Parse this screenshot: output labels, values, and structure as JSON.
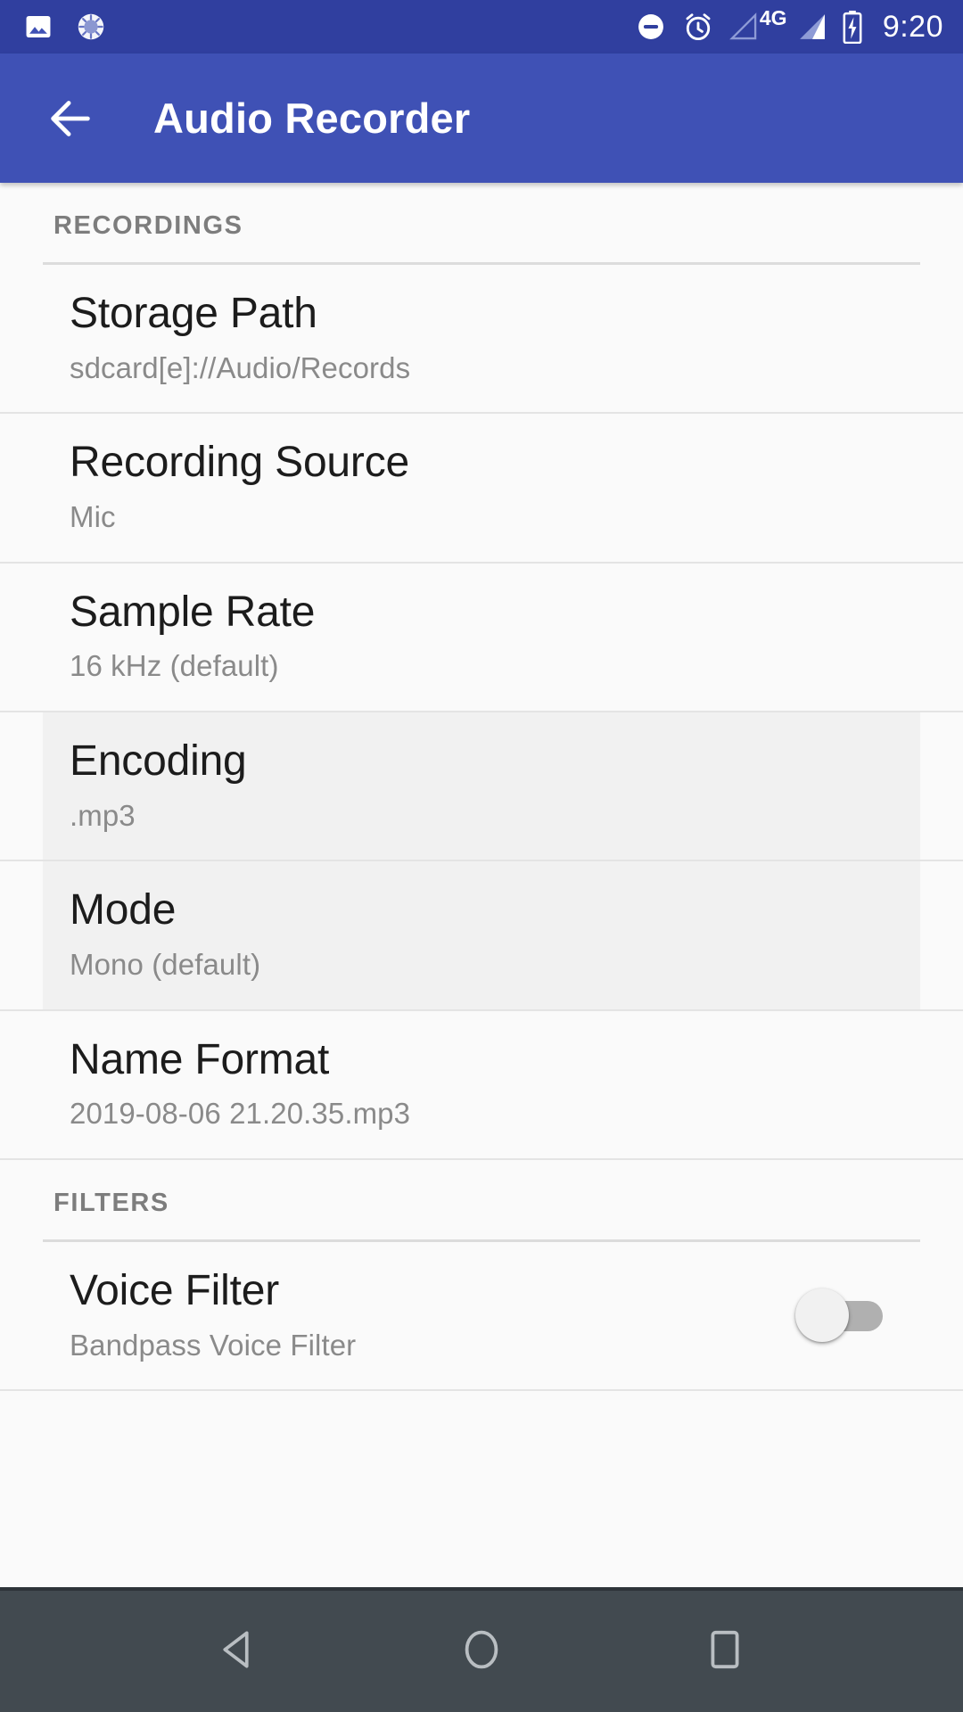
{
  "status_bar": {
    "background_color": "#303F9F",
    "clock": "9:20",
    "network_label": "4G",
    "left_icons": [
      {
        "name": "photo-icon"
      },
      {
        "name": "sync-spinner-icon"
      }
    ],
    "right_icons": [
      {
        "name": "do-not-disturb-icon"
      },
      {
        "name": "alarm-clock-icon"
      },
      {
        "name": "signal-empty-icon"
      },
      {
        "name": "signal-bars-icon"
      },
      {
        "name": "battery-charging-icon"
      }
    ]
  },
  "app_bar": {
    "background_color": "#3F51B5",
    "back_icon": "arrow-left-icon",
    "title": "Audio Recorder"
  },
  "sections": [
    {
      "header": "RECORDINGS",
      "items": [
        {
          "title": "Storage Path",
          "summary": "sdcard[e]://Audio/Records",
          "highlighted": false,
          "has_toggle": false
        },
        {
          "title": "Recording Source",
          "summary": "Mic",
          "highlighted": false,
          "has_toggle": false
        },
        {
          "title": "Sample Rate",
          "summary": "16 kHz (default)",
          "highlighted": false,
          "has_toggle": false
        },
        {
          "title": "Encoding",
          "summary": ".mp3",
          "highlighted": true,
          "has_toggle": false
        },
        {
          "title": "Mode",
          "summary": "Mono (default)",
          "highlighted": true,
          "has_toggle": false
        },
        {
          "title": "Name Format",
          "summary": "2019-08-06 21.20.35.mp3",
          "highlighted": false,
          "has_toggle": false
        }
      ]
    },
    {
      "header": "FILTERS",
      "items": [
        {
          "title": "Voice Filter",
          "summary": "Bandpass Voice Filter",
          "highlighted": false,
          "has_toggle": true,
          "toggle_on": false
        }
      ]
    }
  ],
  "nav_bar": {
    "background_color": "#424A50",
    "buttons": [
      {
        "name": "nav-back-button",
        "icon": "triangle-left-icon"
      },
      {
        "name": "nav-home-button",
        "icon": "circle-icon"
      },
      {
        "name": "nav-recents-button",
        "icon": "square-icon"
      }
    ]
  }
}
